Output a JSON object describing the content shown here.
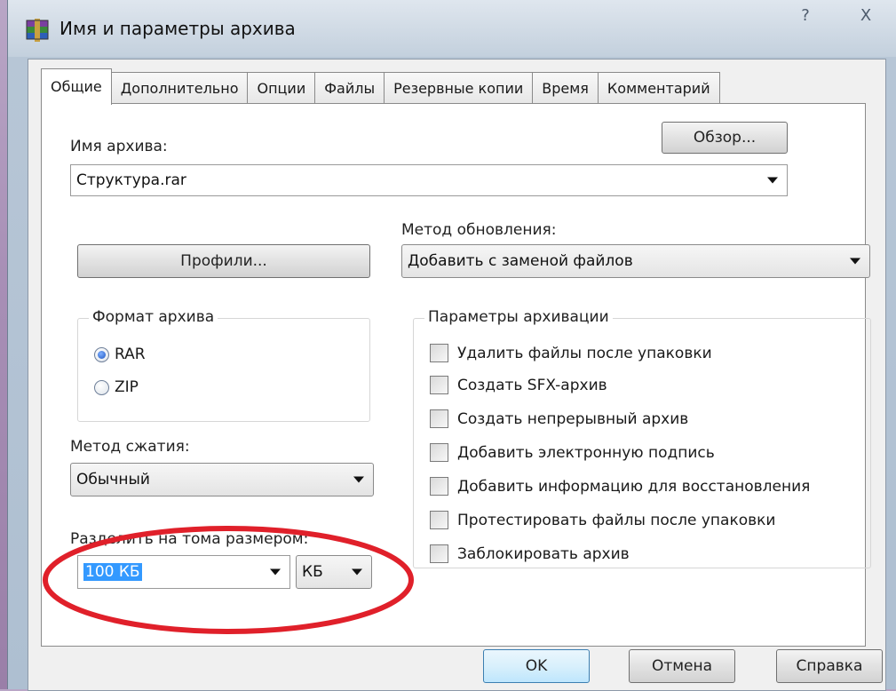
{
  "window": {
    "title": "Имя и параметры архива",
    "help_glyph": "?",
    "close_glyph": "X"
  },
  "tabs": [
    {
      "label": "Общие",
      "active": true
    },
    {
      "label": "Дополнительно"
    },
    {
      "label": "Опции"
    },
    {
      "label": "Файлы"
    },
    {
      "label": "Резервные копии"
    },
    {
      "label": "Время"
    },
    {
      "label": "Комментарий"
    }
  ],
  "general": {
    "archive_name_label": "Имя архива:",
    "browse_button": "Обзор...",
    "archive_name_value": "Структура.rar",
    "update_method_label": "Метод обновления:",
    "update_method_value": "Добавить с заменой файлов",
    "profiles_button": "Профили...",
    "format_group": {
      "label": "Формат архива",
      "options": [
        {
          "label": "RAR",
          "checked": true
        },
        {
          "label": "ZIP",
          "checked": false
        }
      ]
    },
    "compression_label": "Метод сжатия:",
    "compression_value": "Обычный",
    "split_label": "Разделить на тома размером:",
    "split_value": "100 КБ",
    "split_unit": "КБ",
    "params_group": {
      "label": "Параметры архивации",
      "options": [
        "Удалить файлы после упаковки",
        "Создать SFX-архив",
        "Создать непрерывный архив",
        "Добавить электронную подпись",
        "Добавить информацию для восстановления",
        "Протестировать файлы после упаковки",
        "Заблокировать архив"
      ]
    }
  },
  "footer": {
    "ok": "OK",
    "cancel": "Отмена",
    "help": "Справка"
  },
  "colors": {
    "annotation": "#e0202a",
    "selection": "#3399ff"
  }
}
